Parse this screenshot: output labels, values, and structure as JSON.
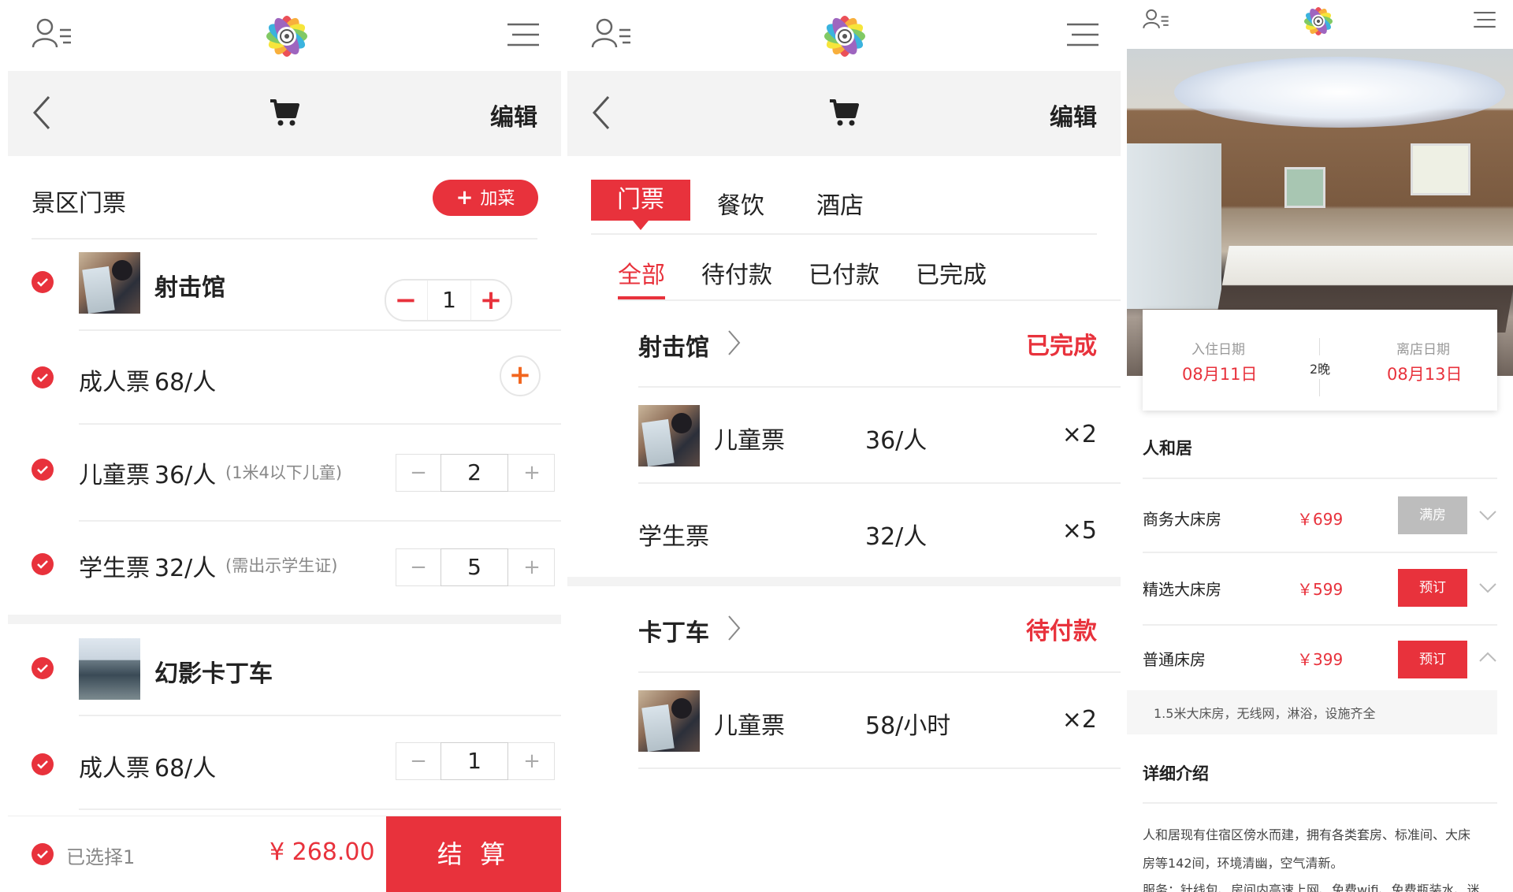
{
  "colors": {
    "accent": "#e8323c",
    "muted_text": "#888888",
    "band": "#f3f3f3"
  },
  "common": {
    "edit_label": "编辑"
  },
  "cart": {
    "section_title": "景区门票",
    "add_button": "加菜",
    "groups": [
      {
        "name": "射击馆",
        "stepper_value": "1",
        "items": [
          {
            "name": "成人票",
            "price": "68/人",
            "note": ""
          },
          {
            "name": "儿童票",
            "price": "36/人",
            "note": "(1米4以下儿童)",
            "qty": "2"
          },
          {
            "name": "学生票",
            "price": "32/人",
            "note": "(需出示学生证)",
            "qty": "5"
          }
        ]
      },
      {
        "name": "幻影卡丁车",
        "items": [
          {
            "name": "成人票",
            "price": "68/人",
            "qty": "1"
          }
        ]
      }
    ],
    "footer": {
      "selected": "已选择1",
      "total": "¥ 268.00",
      "checkout": "结 算"
    }
  },
  "orders": {
    "tabs": [
      "门票",
      "餐饮",
      "酒店"
    ],
    "subtabs": [
      "全部",
      "待付款",
      "已付款",
      "已完成"
    ],
    "groups": [
      {
        "venue": "射击馆",
        "status": "已完成",
        "items": [
          {
            "name": "儿童票",
            "price": "36/人",
            "qty": "×2"
          },
          {
            "name": "学生票",
            "price": "32/人",
            "qty": "×5"
          }
        ]
      },
      {
        "venue": "卡丁车",
        "status": "待付款",
        "items": [
          {
            "name": "儿童票",
            "price": "58/小时",
            "qty": "×2"
          }
        ]
      }
    ]
  },
  "hotel": {
    "checkin_label": "入住日期",
    "checkin_date": "08月11日",
    "nights": "2晚",
    "checkout_label": "离店日期",
    "checkout_date": "08月13日",
    "name": "人和居",
    "rooms": [
      {
        "name": "商务大床房",
        "price": "￥699",
        "button": "满房"
      },
      {
        "name": "精选大床房",
        "price": "￥599",
        "button": "预订"
      },
      {
        "name": "普通床房",
        "price": "￥399",
        "button": "预订"
      }
    ],
    "room_detail": "1.5米大床房，无线网，淋浴，设施齐全",
    "intro_title": "详细介绍",
    "intro_line1": "人和居现有住宿区傍水而建，拥有各类套房、标准间、大床",
    "intro_line2": "房等142间，环境清幽，空气清新。",
    "intro_line3": "服务：针线包、房间内高速上网、免费wifi、免费瓶装水、迷"
  }
}
